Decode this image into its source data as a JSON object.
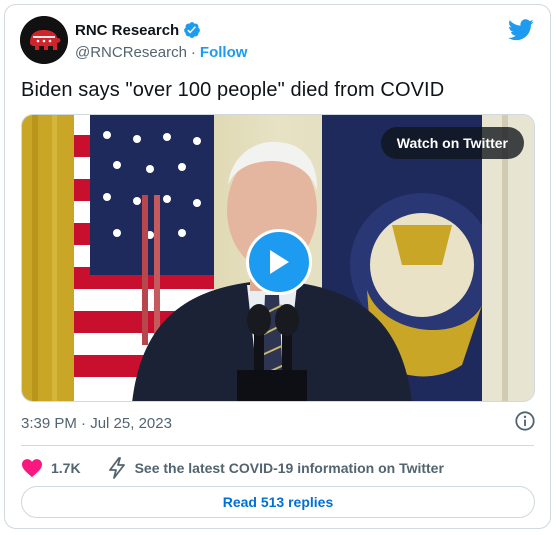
{
  "author": {
    "display_name": "RNC Research",
    "handle": "@RNCResearch",
    "separator": "·",
    "follow_label": "Follow",
    "verified_icon": "verified-badge-icon",
    "avatar_icon": "elephant-logo"
  },
  "tweet": {
    "text": "Biden says \"over 100 people\" died from COVID",
    "time": "3:39 PM",
    "date_separator": "·",
    "date": "Jul 25, 2023"
  },
  "media": {
    "watch_label": "Watch on Twitter",
    "play_icon": "play-icon"
  },
  "actions": {
    "like_count": "1.7K",
    "covid_info": "See the latest COVID-19 information on Twitter",
    "read_replies": "Read 513 replies"
  },
  "colors": {
    "accent": "#1d9bf0",
    "like": "#f91880",
    "secondary_text": "#536471",
    "border": "#cfd9de"
  }
}
